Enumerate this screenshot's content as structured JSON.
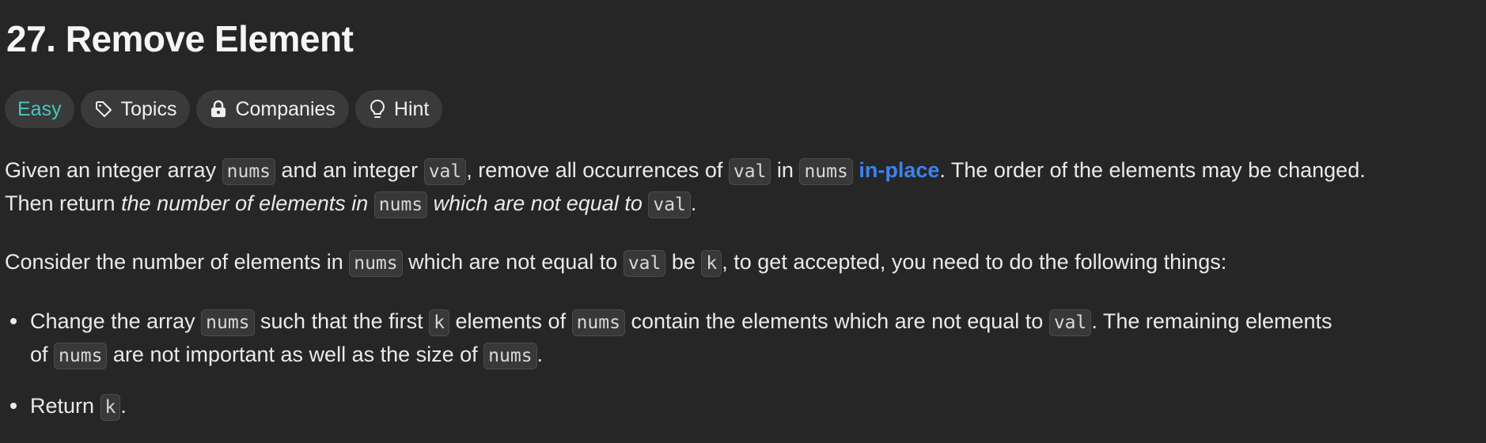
{
  "title": "27. Remove Element",
  "tags": {
    "difficulty": "Easy",
    "topics": "Topics",
    "companies": "Companies",
    "hint": "Hint"
  },
  "icons": {
    "topics": "tag-icon",
    "companies": "lock-icon",
    "hint": "lightbulb-icon"
  },
  "colors": {
    "background": "#262626",
    "easy": "#46c6c2",
    "link": "#3d82f0"
  },
  "p1": {
    "l1_a": "Given an integer array ",
    "l1_c1": "nums",
    "l1_b": " and an integer ",
    "l1_c2": "val",
    "l1_c": ", remove all occurrences of ",
    "l1_c3": "val",
    "l1_d": " in ",
    "l1_c4": "nums",
    "l1_e": " ",
    "l1_link": "in-place",
    "l1_f": ". The order of the elements may be changed.",
    "l2_a": "Then return ",
    "l2_em1": "the number of elements in ",
    "l2_c1": "nums",
    "l2_em2": " which are not equal to ",
    "l2_c2": "val",
    "l2_b": "."
  },
  "p2": {
    "a": "Consider the number of elements in ",
    "c1": "nums",
    "b": " which are not equal to ",
    "c2": "val",
    "c": " be ",
    "c3": "k",
    "d": ", to get accepted, you need to do the following things:"
  },
  "bullets": {
    "b1_l1_a": "Change the array ",
    "b1_l1_c1": "nums",
    "b1_l1_b": " such that the first ",
    "b1_l1_c2": "k",
    "b1_l1_c": " elements of ",
    "b1_l1_c3": "nums",
    "b1_l1_d": " contain the elements which are not equal to ",
    "b1_l1_c4": "val",
    "b1_l1_e": ". The remaining elements",
    "b1_l2_a": "of ",
    "b1_l2_c1": "nums",
    "b1_l2_b": " are not important as well as the size of ",
    "b1_l2_c2": "nums",
    "b1_l2_c": ".",
    "b2_a": "Return ",
    "b2_c1": "k",
    "b2_b": "."
  }
}
